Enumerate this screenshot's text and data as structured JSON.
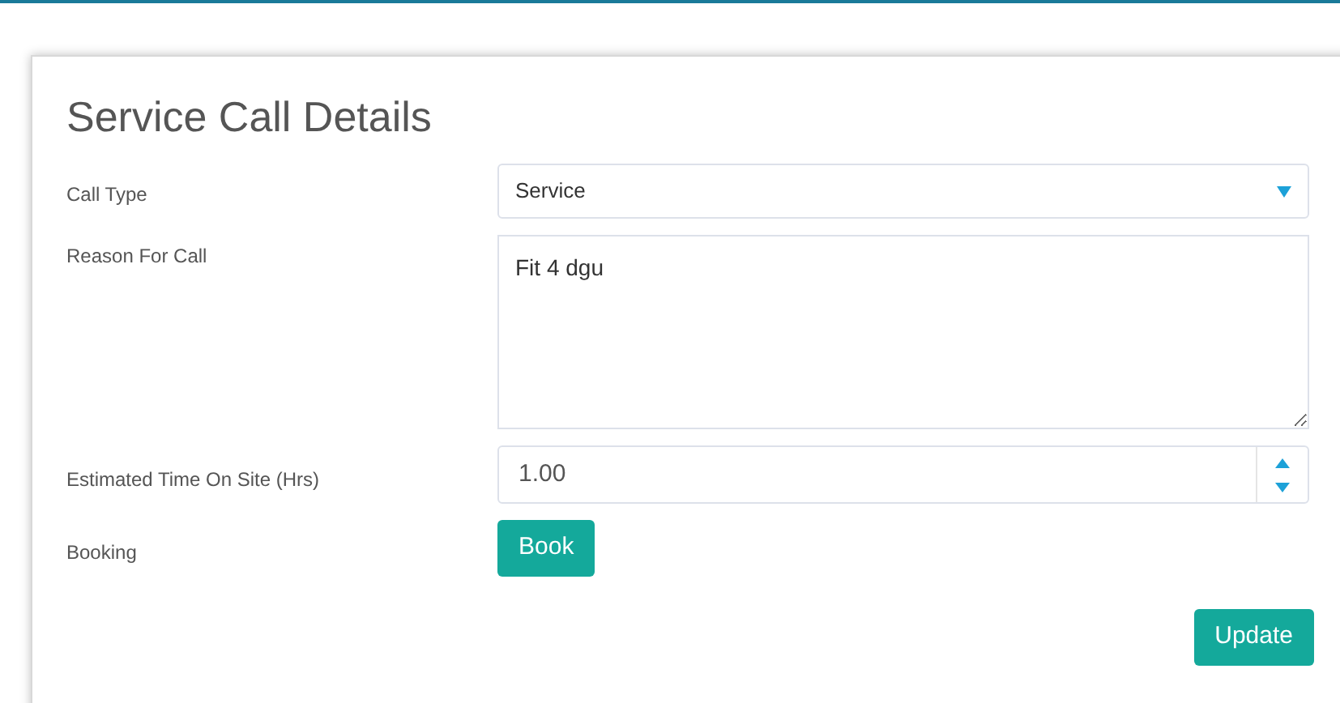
{
  "title": "Service Call Details",
  "fields": [
    {
      "kind": "select",
      "label": "Call Type",
      "value": "Service"
    },
    {
      "kind": "textarea",
      "label": "Reason For Call",
      "value": "Fit 4 dgu"
    },
    {
      "kind": "number",
      "label": "Estimated Time On Site (Hrs)",
      "value": "1.00"
    },
    {
      "kind": "button",
      "label": "Booking",
      "value": "Book"
    }
  ],
  "submit": "Update"
}
